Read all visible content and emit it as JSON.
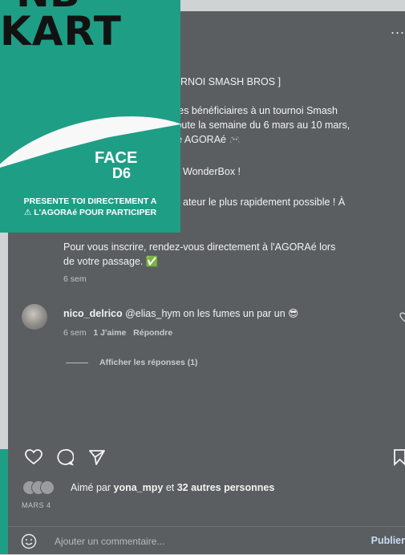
{
  "card": {
    "title_top": "NB",
    "title": "KART",
    "logo_line1": "FACE",
    "logo_line2": "D6",
    "cta_line1": "PRESENTE TOI DIRECTEMENT A",
    "cta_line2": "⚠ L'AGORAé POUR PARTICIPER"
  },
  "post": {
    "more": "...",
    "line1": "URNOI SMASH BROS ]",
    "line2": "ses bénéficiaires à un tournoi Smash",
    "line3": "toute la semaine du 6 mars au 10 mars,",
    "line4": "re AGORAé 🎮",
    "line5": "WonderBox !",
    "line6": "ateur le plus rapidement possible ! À",
    "line7": "Pour vous inscrire, rendez-vous directement à l'AGORAé lors",
    "line8": "de votre passage. ✅",
    "time": "6 sem"
  },
  "comment": {
    "username": "nico_delrico",
    "text": " @elias_hym on les fumes un par un 😎",
    "time": "6 sem",
    "likes": "1 J'aime",
    "reply": "Répondre",
    "show_replies": "Afficher les réponses (1)"
  },
  "likes": {
    "prefix": "Aimé par ",
    "user": "yona_mpy",
    "middle": " et ",
    "others": "32 autres personnes"
  },
  "date": "MARS 4",
  "comment_box": {
    "placeholder": "Ajouter un commentaire...",
    "publish": "Publier"
  },
  "colors": {
    "panel": "#5a5e60",
    "card": "#1f9e86",
    "publish": "#c9dcf5"
  }
}
